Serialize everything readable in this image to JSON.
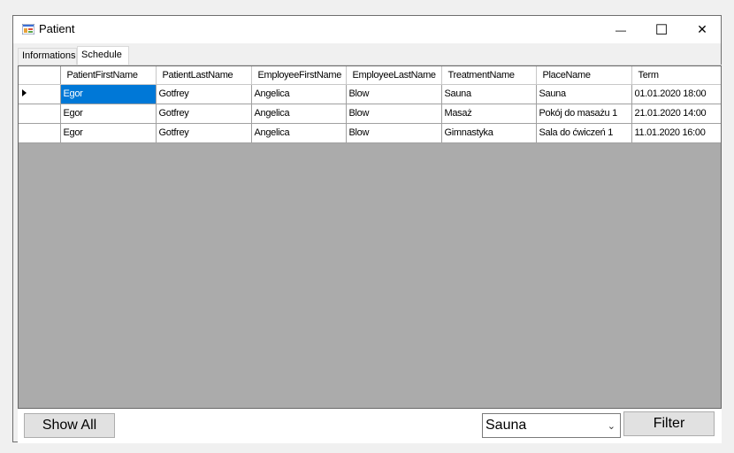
{
  "window": {
    "title": "Patient",
    "minimize_glyph": "—",
    "maximize_glyph": "☐",
    "close_glyph": "✕"
  },
  "tabs": [
    {
      "label": "Informations",
      "active": false
    },
    {
      "label": "Schedule",
      "active": true
    }
  ],
  "grid": {
    "columns": [
      "PatientFirstName",
      "PatientLastName",
      "EmployeeFirstName",
      "EmployeeLastName",
      "TreatmentName",
      "PlaceName",
      "Term"
    ],
    "rows": [
      [
        "Egor",
        "Gotfrey",
        "Angelica",
        "Blow",
        "Sauna",
        "Sauna",
        "01.01.2020 18:00"
      ],
      [
        "Egor",
        "Gotfrey",
        "Angelica",
        "Blow",
        "Masaż",
        "Pokój do masażu 1",
        "21.01.2020 14:00"
      ],
      [
        "Egor",
        "Gotfrey",
        "Angelica",
        "Blow",
        "Gimnastyka",
        "Sala do ćwiczeń 1",
        "11.01.2020 16:00"
      ]
    ],
    "selected_row": 0,
    "selected_column": 0
  },
  "footer": {
    "show_all_label": "Show All",
    "filter_value": "Sauna",
    "filter_label": "Filter"
  },
  "colors": {
    "selection": "#0078d7",
    "grid_background": "#ababab",
    "window_background": "#f0f0f0"
  }
}
